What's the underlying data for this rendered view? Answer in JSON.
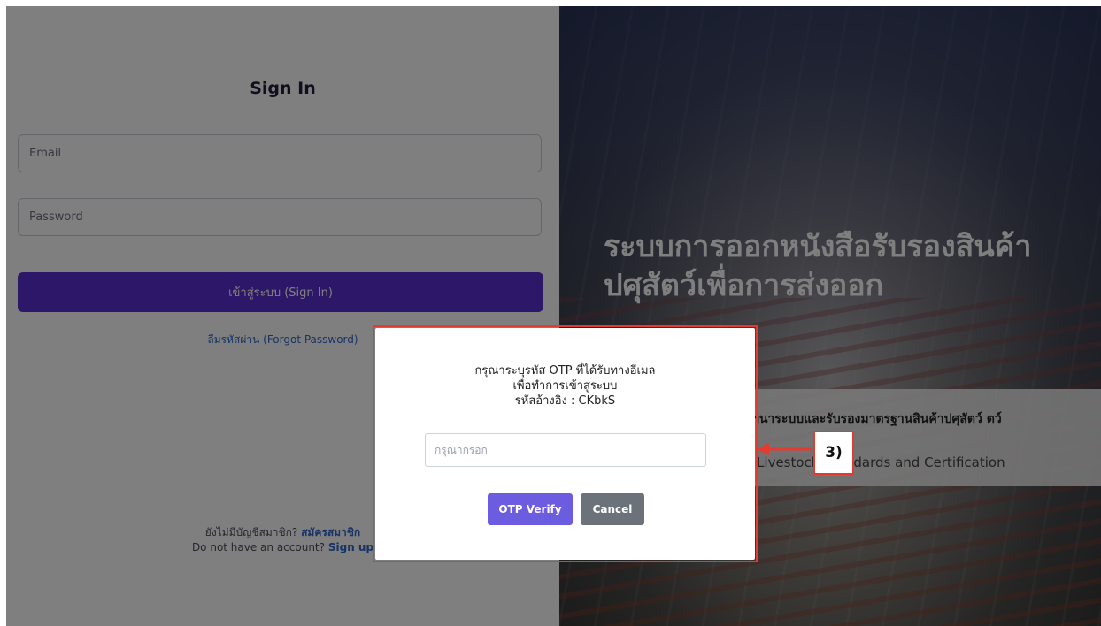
{
  "signin": {
    "title": "Sign In",
    "email_placeholder": "Email",
    "password_placeholder": "Password",
    "submit_label": "เข้าสู่ระบบ (Sign In)",
    "forgot_label": "ลืมรหัสผ่าน (Forgot Password)",
    "no_account_th": "ยังไม่มีบัญชีสมาชิก?",
    "signup_th": "สมัครสมาชิก",
    "no_account_en": "Do not have an account?",
    "signup_en": "Sign up"
  },
  "hero": {
    "title": "ระบบการออกหนังสือรับรองสินค้าปศุสัตว์เพื่อการส่งออก",
    "banner_th": "ฯนาระบบและรับรองมาตรฐานสินค้าปศุสัตว์ ตว์",
    "banner_en": "f Livestock Standards and Certification"
  },
  "modal": {
    "line1": "กรุณาระบุรหัส OTP ที่ได้รับทางอีเมล",
    "line2": "เพื่อทำการเข้าสู่ระบบ",
    "line3": "รหัสอ้างอิง : CKbkS",
    "otp_placeholder": "กรุณากรอก",
    "verify_label": "OTP Verify",
    "cancel_label": "Cancel"
  },
  "annotation": {
    "label": "3)"
  },
  "colors": {
    "primary": "#5b2fd1",
    "verify": "#6c5ce0",
    "cancel": "#6b727a",
    "annotation": "#e53a2f",
    "link": "#2f66cc"
  }
}
